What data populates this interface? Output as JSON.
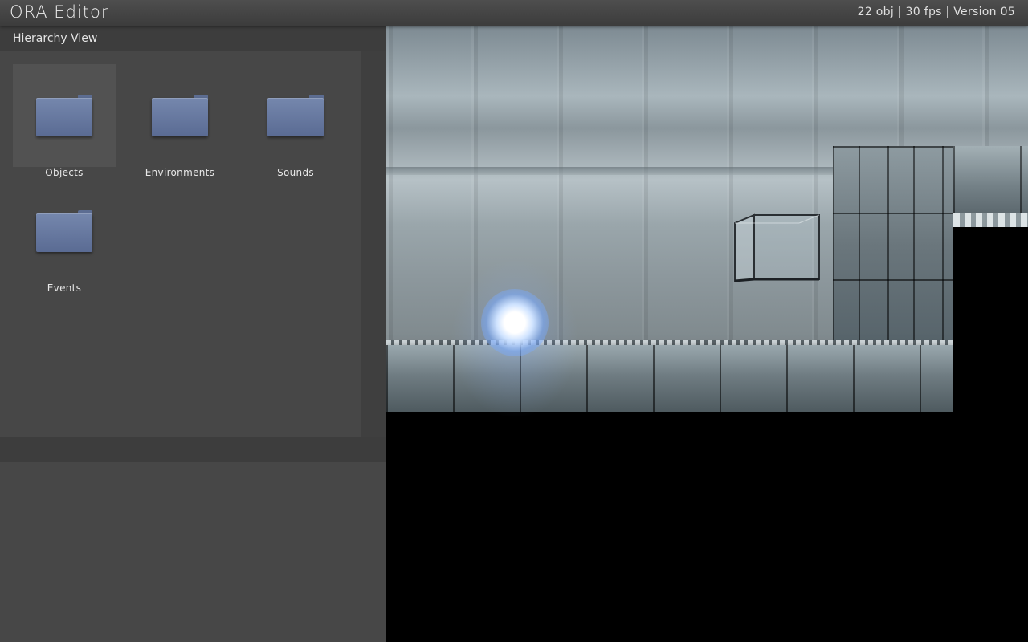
{
  "app": {
    "title": "ORA Editor",
    "status": "22 obj | 30 fps | Version 05"
  },
  "hierarchy": {
    "title": "Hierarchy View",
    "folders": [
      {
        "label": "Objects",
        "selected": true
      },
      {
        "label": "Environments",
        "selected": false
      },
      {
        "label": "Sounds",
        "selected": false
      },
      {
        "label": "Events",
        "selected": false
      }
    ]
  },
  "inspector": {
    "title": ""
  },
  "colors": {
    "panel": "#474747",
    "header": "#3d3d3d",
    "folder": "#6a7ba1"
  },
  "icons": [
    "folder-icon"
  ]
}
